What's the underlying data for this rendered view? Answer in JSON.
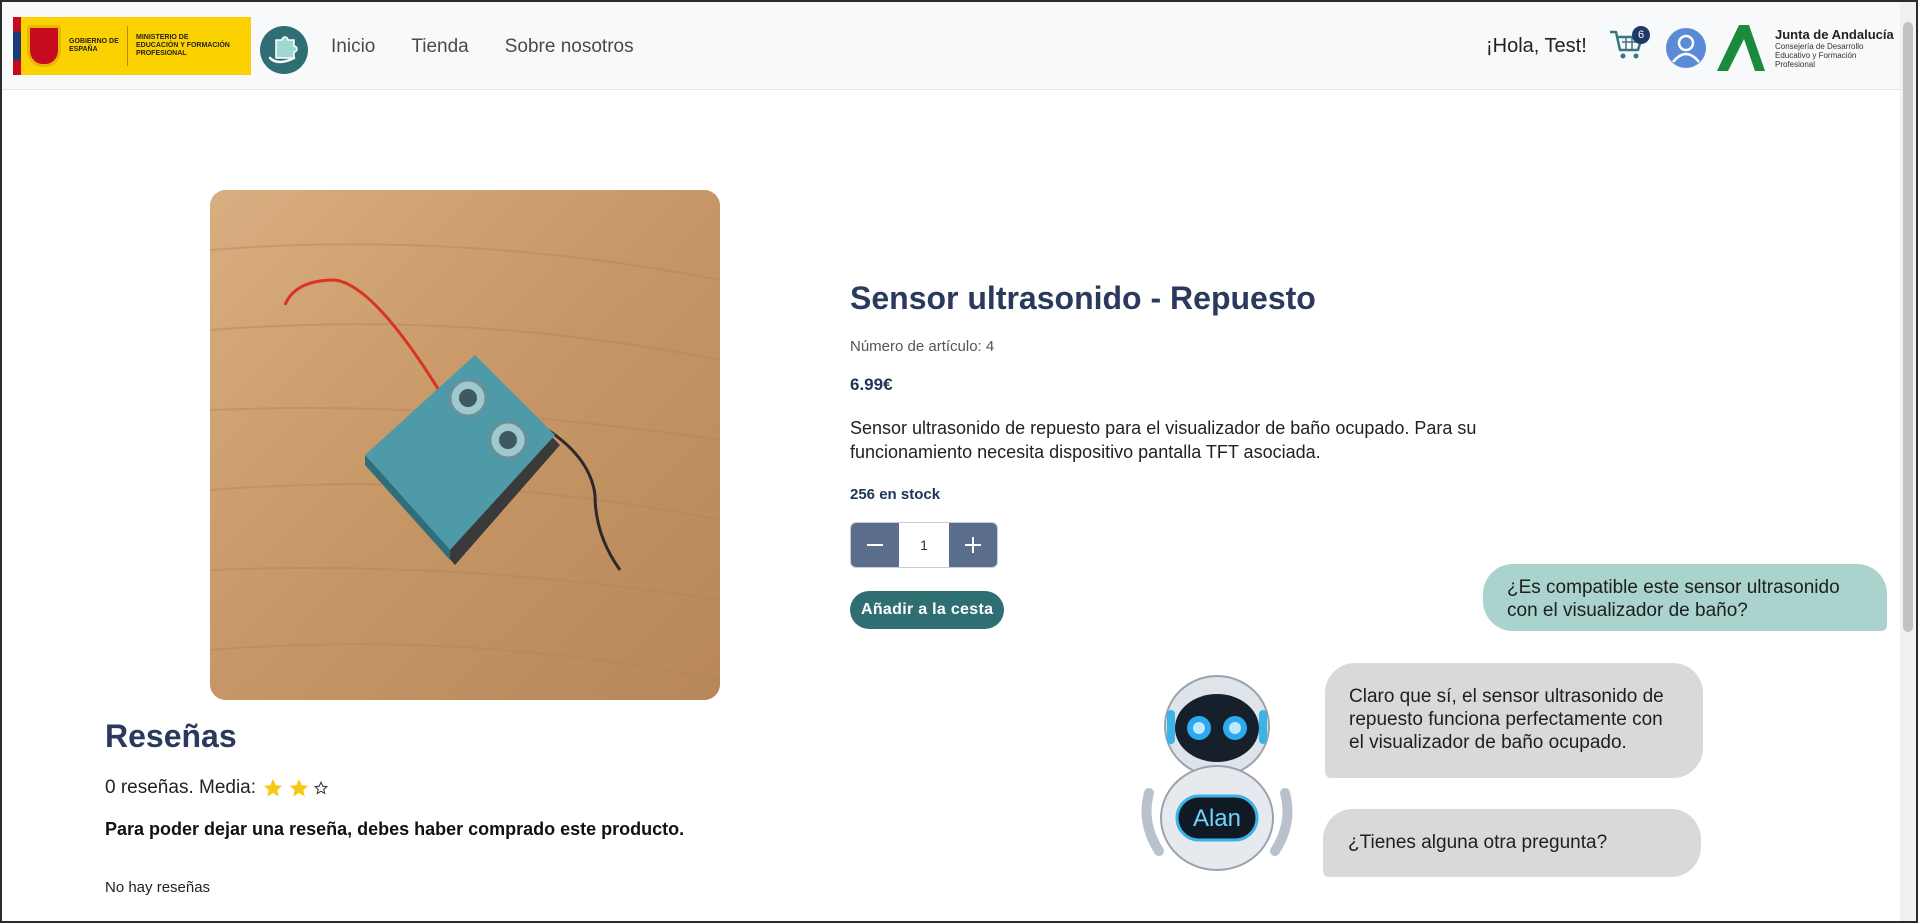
{
  "nav": {
    "gov_logo_text": "GOBIERNO DE ESPAÑA",
    "ministry_text": "MINISTERIO DE EDUCACIÓN Y FORMACIÓN PROFESIONAL",
    "links": [
      "Inicio",
      "Tienda",
      "Sobre nosotros"
    ],
    "greeting": "¡Hola, Test!",
    "cart_count": "6",
    "junta_title": "Junta de Andalucía",
    "junta_sub": "Consejería de Desarrollo Educativo y Formación Profesional"
  },
  "product": {
    "title": "Sensor ultrasonido - Repuesto",
    "sku": "Número de artículo: 4",
    "price": "6.99€",
    "description": "Sensor ultrasonido de repuesto para el visualizador de baño ocupado. Para su funcionamiento necesita dispositivo pantalla TFT asociada.",
    "stock": "256 en stock",
    "quantity": "1",
    "add_to_cart": "Añadir a la cesta"
  },
  "reviews": {
    "title": "Reseñas",
    "summary": "0 reseñas. Media:",
    "rating_stars": {
      "filled": 2,
      "total": 3
    },
    "warning": "Para poder dejar una reseña, debes haber comprado este producto.",
    "empty": "No hay reseñas"
  },
  "chat": {
    "user_message": "¿Es compatible este sensor ultrasonido con el visualizador de baño?",
    "bot_message_1": "Claro que sí, el sensor ultrasonido de repuesto funciona perfectamente con el visualizador de baño ocupado.",
    "bot_message_2": "¿Tienes alguna otra pregunta?",
    "bot_name": "Alan"
  },
  "colors": {
    "accent_teal": "#2f6f73",
    "title_navy": "#2b3a5c",
    "qty_button": "#5a6e8b",
    "user_bubble": "#a9d3cc",
    "bot_bubble": "#d9d9d9"
  }
}
